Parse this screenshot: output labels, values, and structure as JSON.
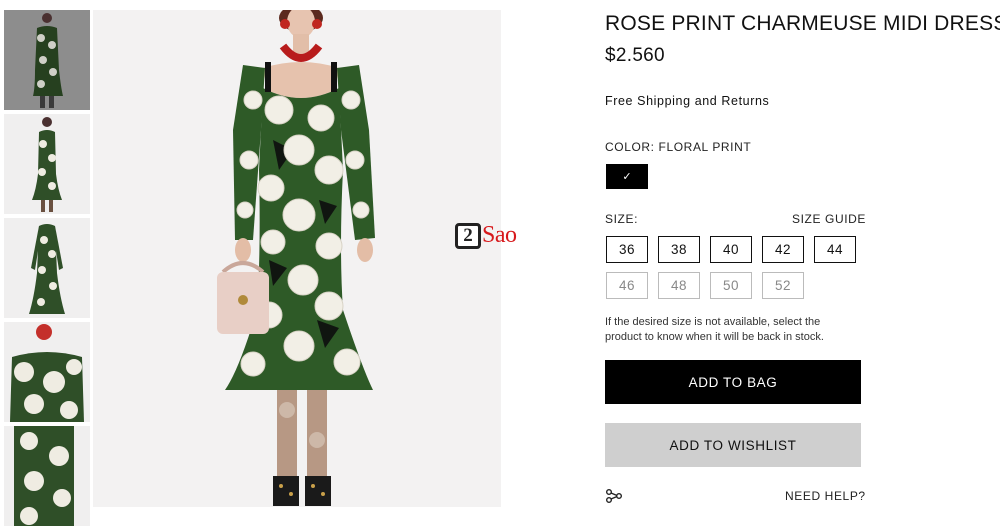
{
  "product": {
    "title": "ROSE PRINT CHARMEUSE MIDI DRESS",
    "price": "$2.560",
    "shipping": "Free Shipping and Returns",
    "color_label": "COLOR:",
    "color_value": "FLORAL PRINT",
    "color_check": "✓",
    "size_label": "SIZE:",
    "size_guide": "SIZE GUIDE",
    "sizes_available": [
      "36",
      "38",
      "40",
      "42",
      "44"
    ],
    "sizes_unavailable": [
      "46",
      "48",
      "50",
      "52"
    ],
    "availability_note": "If the desired size is not available, select the product to know when it will be back in stock.",
    "add_to_bag": "ADD TO BAG",
    "add_to_wishlist": "ADD TO WISHLIST",
    "need_help": "NEED HELP?",
    "share_icon": "share-icon"
  },
  "watermark": {
    "number": "2",
    "text": "Sao",
    "color": "#d7191c"
  },
  "gallery": {
    "thumbnail_count": 5,
    "active_index": 0
  },
  "colors": {
    "black": "#000000",
    "wishlist_gray": "#cfcfcf",
    "dress_green": "#2f6b2a",
    "rose_white": "#f2efe6"
  }
}
